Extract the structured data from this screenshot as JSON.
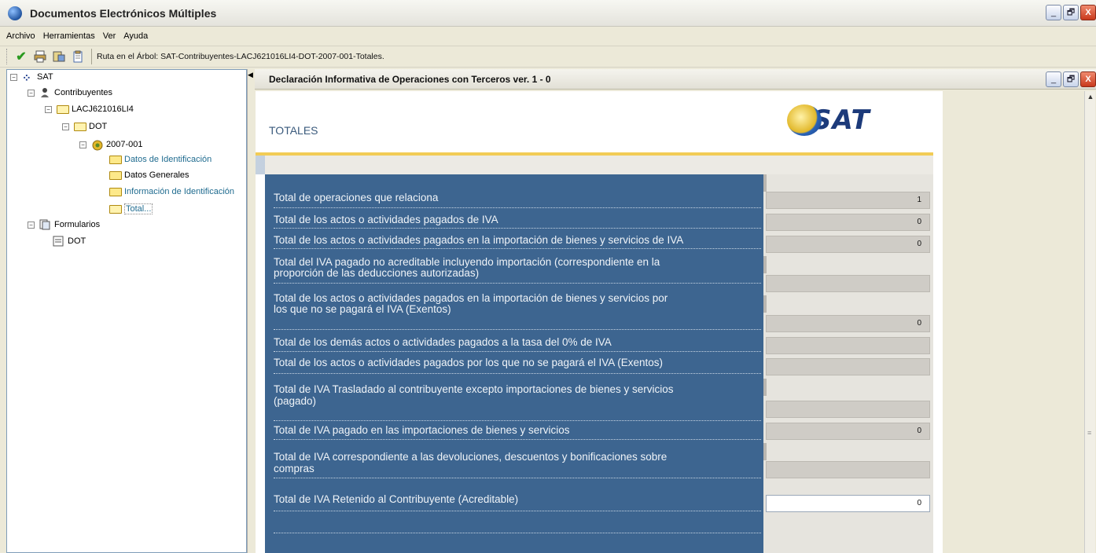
{
  "app": {
    "title": "Documentos Electrónicos Múltiples",
    "window_buttons": [
      "_",
      "🗗",
      "X"
    ]
  },
  "menu": [
    "Archivo",
    "Herramientas",
    "Ver",
    "Ayuda"
  ],
  "toolbar": {
    "icons": [
      "check-icon",
      "print-icon",
      "tools-icon",
      "clipboard-icon"
    ],
    "route_text": "Ruta en el Árbol: SAT-Contribuyentes-LACJ621016LI4-DOT-2007-001-Totales."
  },
  "tree": {
    "root": "SAT",
    "contribuyentes": "Contribuyentes",
    "rfc": "LACJ621016LI4",
    "dot": "DOT",
    "period": "2007-001",
    "leaf1": "Datos de Identificación",
    "leaf2": "Datos Generales",
    "leaf3": "Información de Identificación",
    "leaf4": "Total...",
    "formularios": "Formularios",
    "form_dot": "DOT"
  },
  "document": {
    "title": "Declaración Informativa de Operaciones con Terceros ver. 1 - 0",
    "section_title": "TOTALES",
    "logo_text": "SAT"
  },
  "rows": [
    {
      "label": "Total de operaciones que relaciona",
      "value": "1"
    },
    {
      "label": "Total de los actos o actividades pagados de IVA",
      "value": "0"
    },
    {
      "label": "Total de los actos o actividades pagados en la importación de bienes y servicios de IVA",
      "value": "0"
    },
    {
      "label": "Total del IVA pagado no acreditable incluyendo importación (correspondiente en la",
      "label2": "proporción de las deducciones autorizadas)",
      "value": ""
    },
    {
      "label": "Total de los actos o actividades pagados en la importación de bienes y servicios por",
      "label2": "los que no se pagará el IVA (Exentos)",
      "value": "0"
    },
    {
      "label": "Total de los demás actos o actividades pagados a la tasa del 0% de IVA",
      "value": ""
    },
    {
      "label": "Total de los actos o actividades pagados por los que no se pagará el IVA (Exentos)",
      "value": ""
    },
    {
      "label": "Total de IVA Trasladado al contribuyente excepto importaciones de bienes y servicios",
      "label2": "(pagado)",
      "value": ""
    },
    {
      "label": "Total de IVA pagado en las importaciones de bienes y servicios",
      "value": "0"
    },
    {
      "label": "Total de IVA correspondiente a las devoluciones, descuentos y bonificaciones sobre",
      "label2": "compras",
      "value": ""
    },
    {
      "label": "Total de IVA Retenido al Contribuyente (Acreditable)",
      "value": "0"
    }
  ]
}
